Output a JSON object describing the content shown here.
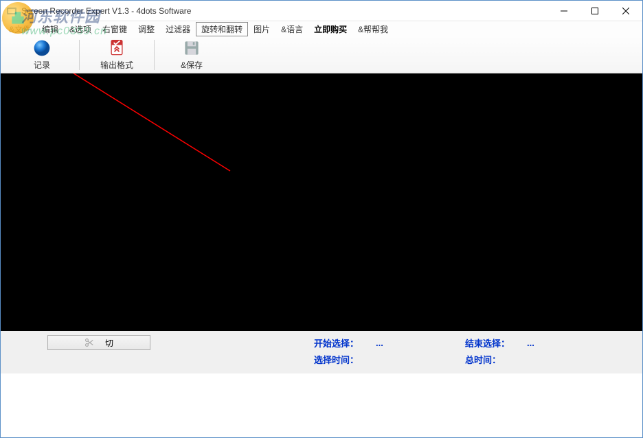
{
  "title": "Screen Recorder Expert V1.3 - 4dots Software",
  "menu": {
    "file": "&文件",
    "edit": "编辑",
    "options": "&选项",
    "hotkeys": "右窗键",
    "adjust": "调整",
    "filters": "过滤器",
    "rotate": "旋转和翻转",
    "image": "图片",
    "language": "&语言",
    "buy": "立即购买",
    "help": "&帮帮我"
  },
  "toolbar": {
    "record": "记录",
    "output": "输出格式",
    "save": "&保存"
  },
  "bottom": {
    "cut": "切",
    "start_sel_label": "开始选择：",
    "start_sel_val": "...",
    "end_sel_label": "结束选择：",
    "end_sel_val": "...",
    "sel_time_label": "选择时间：",
    "sel_time_val": "",
    "total_time_label": "总时间：",
    "total_time_val": ""
  },
  "watermark": {
    "cn": "河东软件园",
    "en": "www.pc0359.cn"
  }
}
